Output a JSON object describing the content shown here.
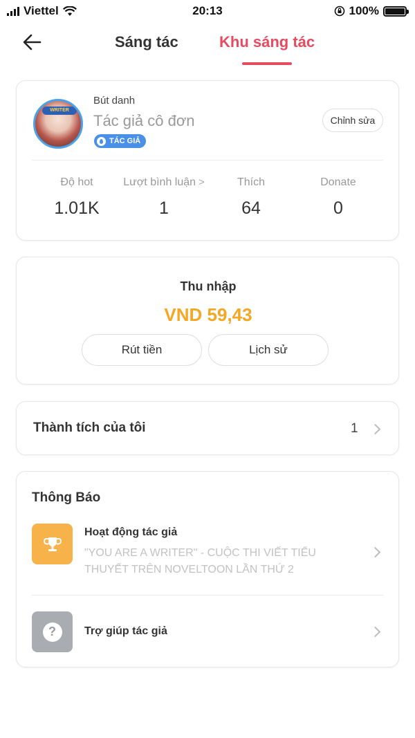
{
  "status_bar": {
    "carrier": "Viettel",
    "time": "20:13",
    "battery": "100%",
    "battery_level": 1.0
  },
  "nav": {
    "tabs": [
      {
        "label": "Sáng tác"
      },
      {
        "label": "Khu sáng tác"
      }
    ],
    "active_tab": 1
  },
  "profile": {
    "pen_label": "Bút danh",
    "pen_name": "Tác giả cô đơn",
    "badge": "TÁC GIẢ",
    "avatar_text": "WRITER",
    "edit_label": "Chỉnh sửa",
    "stats": [
      {
        "label": "Độ hot",
        "value": "1.01K"
      },
      {
        "label": "Lượt bình luận",
        "value": "1"
      },
      {
        "label": "Thích",
        "value": "64"
      },
      {
        "label": "Donate",
        "value": "0"
      }
    ]
  },
  "income": {
    "title": "Thu nhập",
    "amount": "VND 59,43",
    "withdraw_label": "Rút tiền",
    "history_label": "Lịch sử"
  },
  "achievements": {
    "label": "Thành tích của tôi",
    "count": "1"
  },
  "notices": {
    "title": "Thông Báo",
    "items": [
      {
        "title": "Hoạt động tác giả",
        "description": "\"YOU ARE A WRITER\" - CUỘC THI VIẾT TIỂU THUYẾT TRÊN NOVELTOON LẦN THỨ 2",
        "icon": "trophy-icon"
      },
      {
        "title": "Trợ giúp tác giả",
        "icon": "help-icon"
      }
    ]
  },
  "colors": {
    "accent": "#e84a5f",
    "income": "#f5a623",
    "badge": "#4a8fe8",
    "trophy_bg": "#f7b24a",
    "help_bg": "#a9acb0"
  }
}
